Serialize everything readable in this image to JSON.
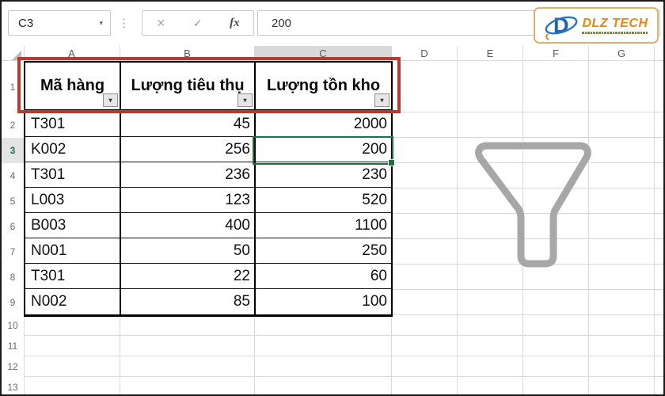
{
  "toolbar": {
    "name_box_value": "C3",
    "name_box_caret": "▾",
    "dots_icon": "⋮",
    "cancel_icon": "✕",
    "commit_icon": "✓",
    "fx_label": "fx",
    "formula_value": "200"
  },
  "logo": {
    "brand": "DLZ TECH"
  },
  "grid": {
    "columns": [
      "A",
      "B",
      "C",
      "D",
      "E",
      "F",
      "G"
    ],
    "rows": [
      "1",
      "2",
      "3",
      "4",
      "5",
      "6",
      "7",
      "8",
      "9",
      "10",
      "11",
      "12",
      "13"
    ],
    "selected_cell": "C3"
  },
  "table": {
    "headers": [
      "Mã hàng",
      "Lượng tiêu thụ",
      "Lượng tồn kho"
    ],
    "filter_caret": "▾",
    "rows": [
      [
        "T301",
        "45",
        "2000"
      ],
      [
        "K002",
        "256",
        "200"
      ],
      [
        "T301",
        "236",
        "230"
      ],
      [
        "L003",
        "123",
        "520"
      ],
      [
        "B003",
        "400",
        "1100"
      ],
      [
        "N001",
        "50",
        "250"
      ],
      [
        "T301",
        "22",
        "60"
      ],
      [
        "N002",
        "85",
        "100"
      ]
    ]
  },
  "colors": {
    "annotation_red": "#b23b32",
    "selection_green": "#1e7145",
    "column_highlight": "#d9d9d9",
    "funnel_gray": "#a7a7a7",
    "logo_orange": "#e8860d",
    "logo_blue": "#1d63b5"
  }
}
